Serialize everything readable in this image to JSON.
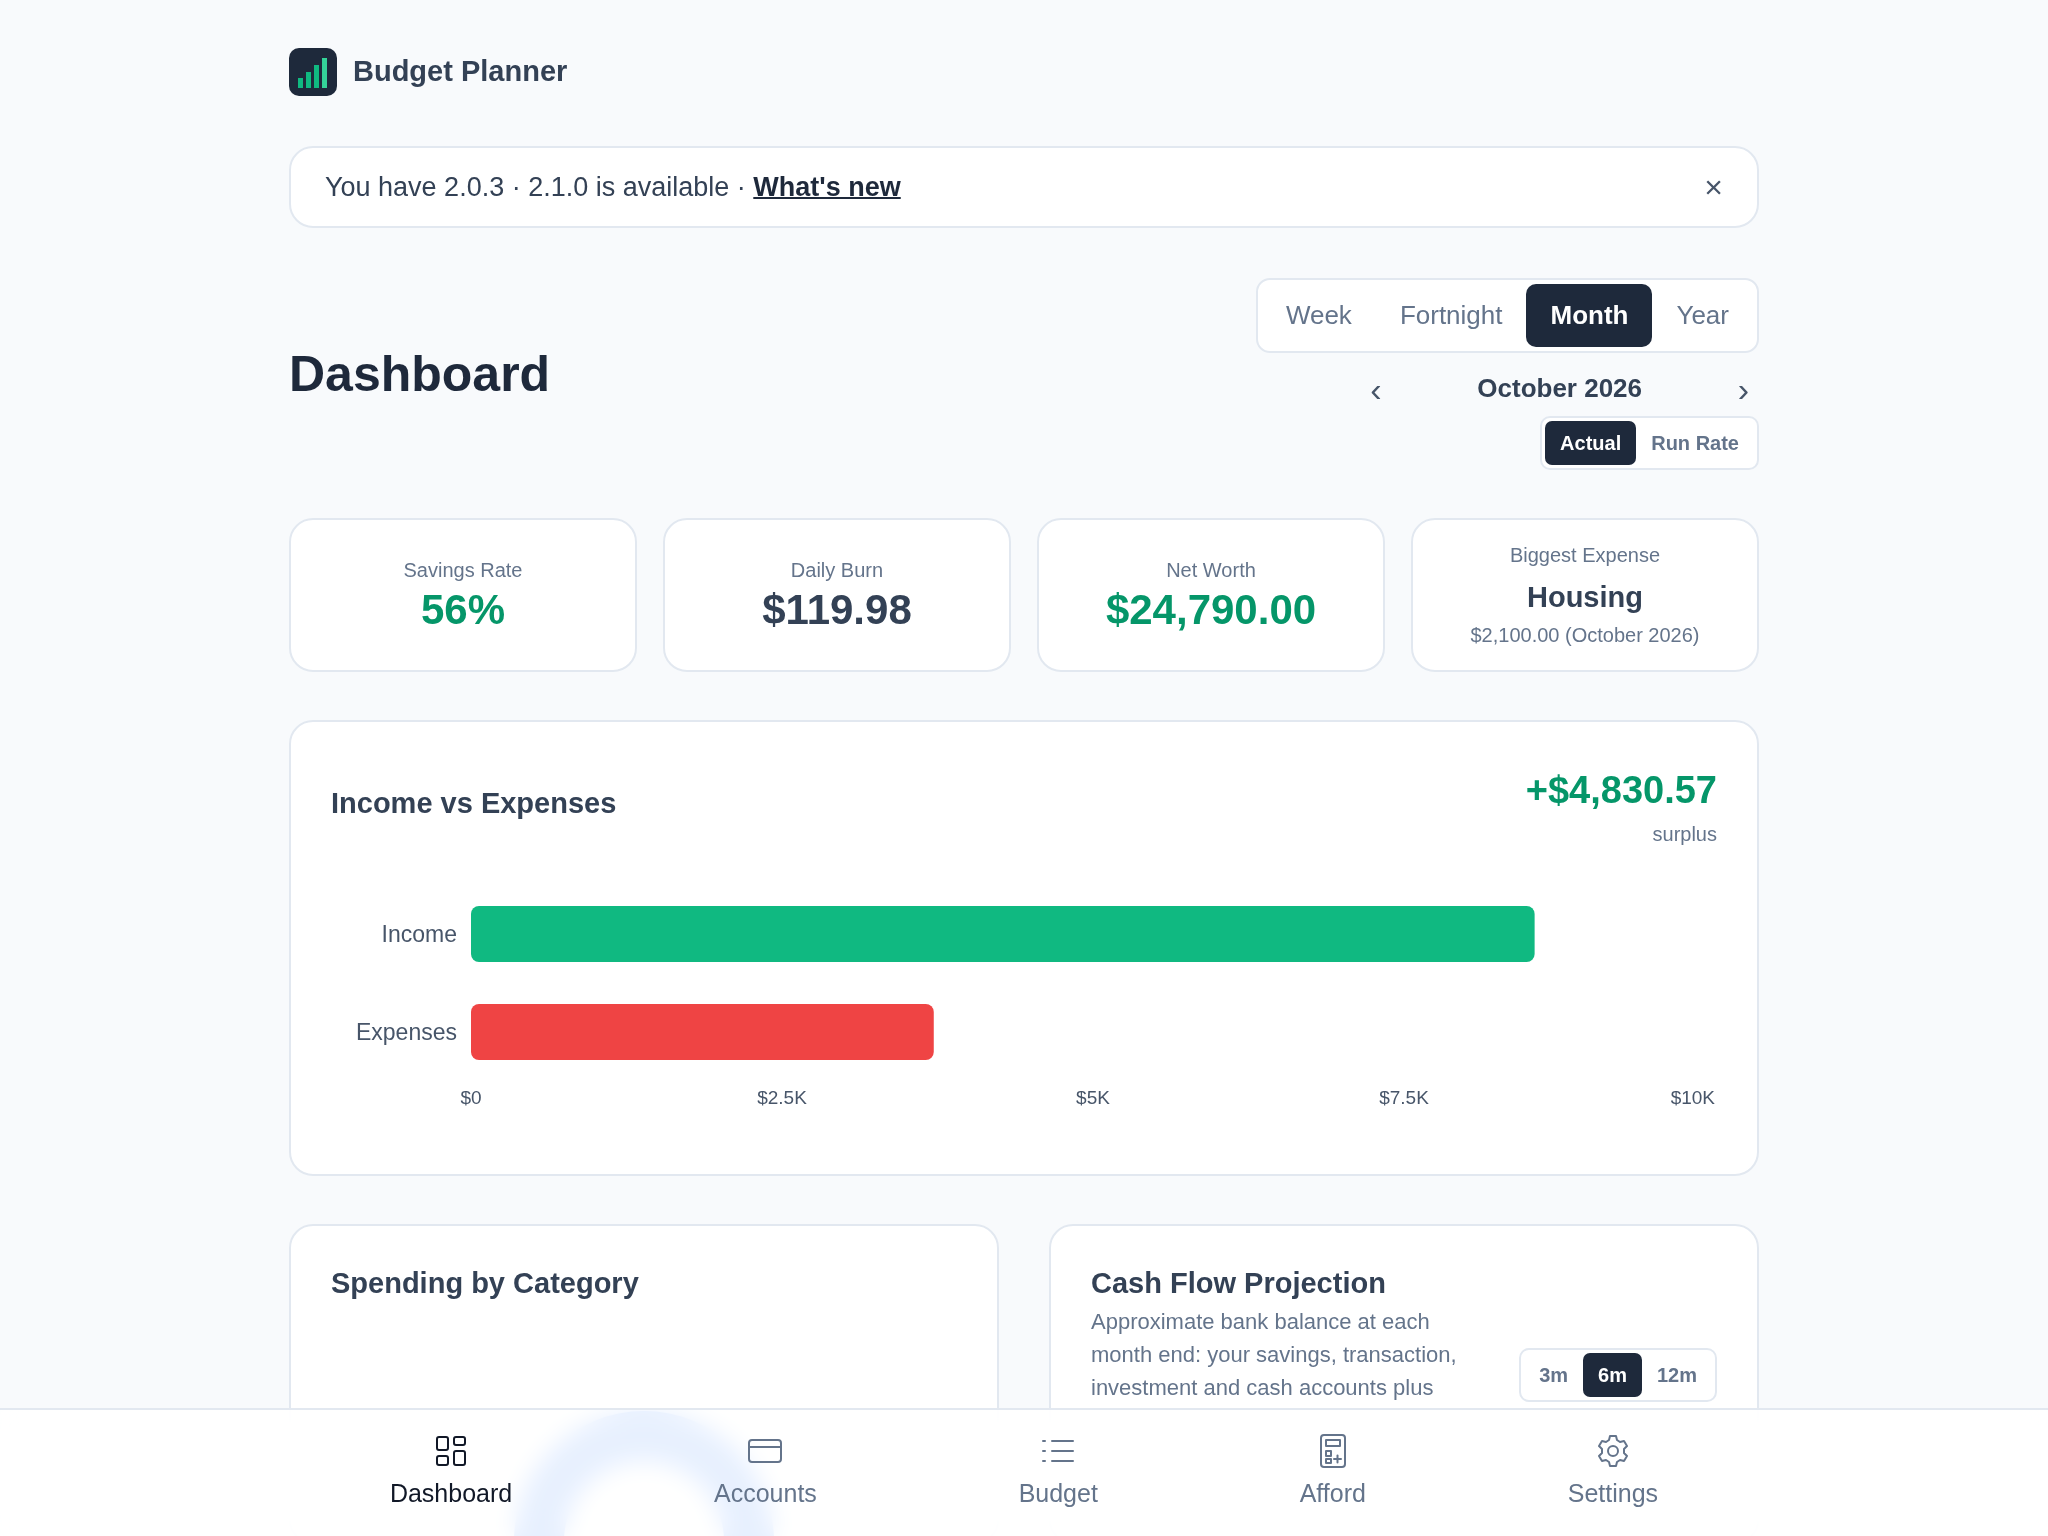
{
  "app": {
    "title": "Budget Planner"
  },
  "update_banner": {
    "message": "You have 2.0.3 · 2.1.0 is available · ",
    "link": "What's new",
    "close": "×"
  },
  "page_title": "Dashboard",
  "period_tabs": [
    {
      "label": "Week",
      "selected": false
    },
    {
      "label": "Fortnight",
      "selected": false
    },
    {
      "label": "Month",
      "selected": true
    },
    {
      "label": "Year",
      "selected": false
    }
  ],
  "period_nav": {
    "prev": "‹",
    "label": "October 2026",
    "next": "›"
  },
  "mode_tabs": [
    {
      "label": "Actual",
      "selected": true
    },
    {
      "label": "Run Rate",
      "selected": false
    }
  ],
  "stats": [
    {
      "label": "Savings Rate",
      "value": "56%",
      "kind": "positive"
    },
    {
      "label": "Daily Burn",
      "value": "$119.98",
      "kind": "neutral"
    },
    {
      "label": "Net Worth",
      "value": "$24,790.00",
      "kind": "positive"
    },
    {
      "label": "Biggest Expense",
      "value": "Housing",
      "detail": "$2,100.00 (October 2026)",
      "kind": "category"
    }
  ],
  "income_vs_expenses": {
    "title": "Income vs Expenses",
    "total": "+$4,830.57",
    "total_caption": "surplus",
    "chart_data": {
      "type": "bar",
      "orientation": "horizontal",
      "series": [
        {
          "name": "Income",
          "color": "#10b981",
          "values": [
            8550
          ]
        },
        {
          "name": "Expenses",
          "color": "#ef4444",
          "values": [
            3720
          ]
        }
      ],
      "xlim": [
        0,
        10000
      ],
      "xticks": [
        {
          "value": 0,
          "label": "$0"
        },
        {
          "value": 2500,
          "label": "$2.5K"
        },
        {
          "value": 5000,
          "label": "$5K"
        },
        {
          "value": 7500,
          "label": "$7.5K"
        },
        {
          "value": 10000,
          "label": "$10K"
        }
      ]
    }
  },
  "spending_by_category": {
    "title": "Spending by Category"
  },
  "cash_flow": {
    "title": "Cash Flow Projection",
    "description": "Approximate bank balance at each month end: your savings, transaction, investment and cash accounts plus",
    "ranges": [
      {
        "label": "3m",
        "selected": false
      },
      {
        "label": "6m",
        "selected": true
      },
      {
        "label": "12m",
        "selected": false
      }
    ]
  },
  "bottom_nav": [
    {
      "label": "Dashboard",
      "selected": true
    },
    {
      "label": "Accounts",
      "selected": false
    },
    {
      "label": "Budget",
      "selected": false
    },
    {
      "label": "Afford",
      "selected": false
    },
    {
      "label": "Settings",
      "selected": false
    }
  ]
}
